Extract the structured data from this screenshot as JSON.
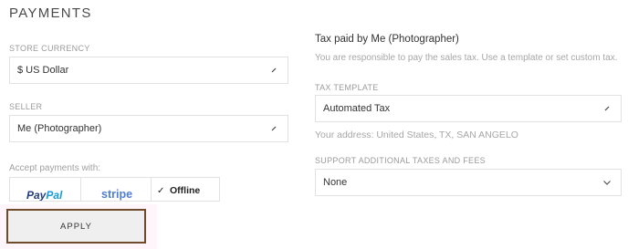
{
  "payments": {
    "heading": "PAYMENTS",
    "store_currency": {
      "label": "STORE CURRENCY",
      "value": "$ US Dollar"
    },
    "seller": {
      "label": "SELLER",
      "value": "Me (Photographer)"
    },
    "accept": {
      "label": "Accept payments with:",
      "options": [
        {
          "name_a": "Pay",
          "name_b": "Pal",
          "icon": "paypal-logo"
        },
        {
          "name": "stripe",
          "icon": "stripe-logo"
        },
        {
          "name": "Offline",
          "checked": true,
          "icon": "check-icon"
        }
      ]
    },
    "apply_label": "APPLY"
  },
  "tax": {
    "title": "Tax paid by Me (Photographer)",
    "description": "You are responsible to pay the sales tax. Use a template or set custom tax.",
    "template": {
      "label": "TAX TEMPLATE",
      "value": "Automated Tax"
    },
    "address": "Your address: United States, TX, SAN ANGELO",
    "additional": {
      "label": "SUPPORT ADDITIONAL TAXES AND FEES",
      "value": "None"
    }
  }
}
